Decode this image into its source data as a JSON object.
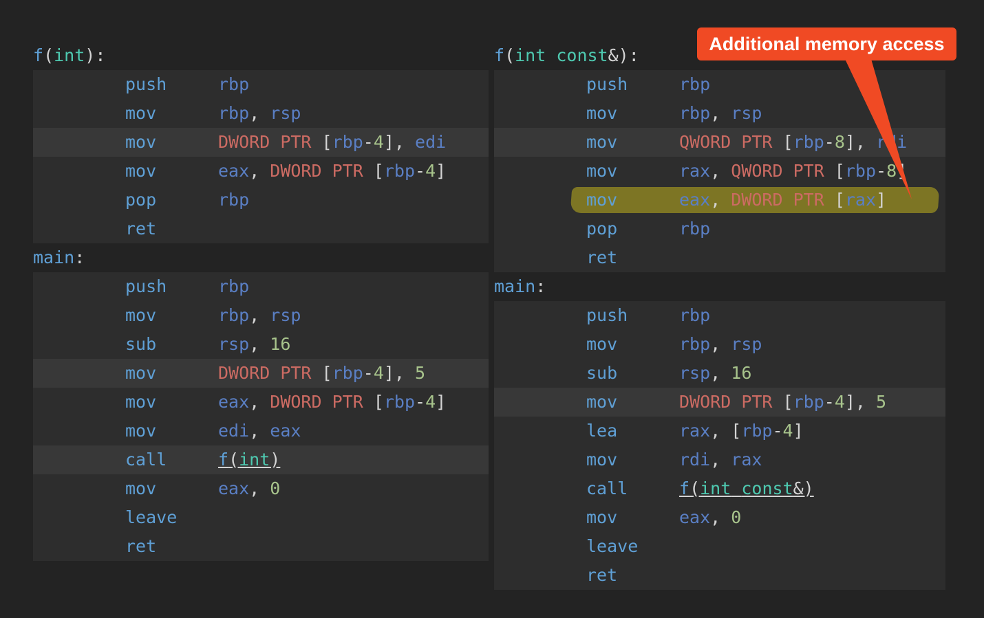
{
  "callout": {
    "text": "Additional memory access",
    "color": "#f04a24"
  },
  "colors": {
    "background": "#232323",
    "code_block": "#2d2d2d",
    "row_highlight": "#383838",
    "register": "#5a7fc4",
    "number": "#a8c48c",
    "keyword": "#cc6b63",
    "mnemonic": "#5fa0d6",
    "type": "#4ec9b0",
    "marker": "#8c8223"
  },
  "left": {
    "fn_label": [
      {
        "t": "f",
        "c": "fn"
      },
      {
        "t": "(",
        "c": "p"
      },
      {
        "t": "int",
        "c": "ty"
      },
      {
        "t": "):",
        "c": "p"
      }
    ],
    "fn_rows": [
      {
        "mn": "push",
        "ops": [
          {
            "t": "rbp",
            "c": "reg"
          }
        ]
      },
      {
        "mn": "mov",
        "ops": [
          {
            "t": "rbp",
            "c": "reg"
          },
          {
            "t": ", ",
            "c": "p"
          },
          {
            "t": "rsp",
            "c": "reg"
          }
        ]
      },
      {
        "mn": "mov",
        "hl": true,
        "ops": [
          {
            "t": "DWORD",
            "c": "kw"
          },
          {
            "t": " ",
            "c": "p"
          },
          {
            "t": "PTR",
            "c": "kw"
          },
          {
            "t": " [",
            "c": "p"
          },
          {
            "t": "rbp",
            "c": "reg"
          },
          {
            "t": "-",
            "c": "p"
          },
          {
            "t": "4",
            "c": "num"
          },
          {
            "t": "], ",
            "c": "p"
          },
          {
            "t": "edi",
            "c": "reg"
          }
        ]
      },
      {
        "mn": "mov",
        "ops": [
          {
            "t": "eax",
            "c": "reg"
          },
          {
            "t": ", ",
            "c": "p"
          },
          {
            "t": "DWORD",
            "c": "kw"
          },
          {
            "t": " ",
            "c": "p"
          },
          {
            "t": "PTR",
            "c": "kw"
          },
          {
            "t": " [",
            "c": "p"
          },
          {
            "t": "rbp",
            "c": "reg"
          },
          {
            "t": "-",
            "c": "p"
          },
          {
            "t": "4",
            "c": "num"
          },
          {
            "t": "]",
            "c": "p"
          }
        ]
      },
      {
        "mn": "pop",
        "ops": [
          {
            "t": "rbp",
            "c": "reg"
          }
        ]
      },
      {
        "mn": "ret",
        "ops": []
      }
    ],
    "main_label": [
      {
        "t": "main",
        "c": "fn"
      },
      {
        "t": ":",
        "c": "p"
      }
    ],
    "main_rows": [
      {
        "mn": "push",
        "ops": [
          {
            "t": "rbp",
            "c": "reg"
          }
        ]
      },
      {
        "mn": "mov",
        "ops": [
          {
            "t": "rbp",
            "c": "reg"
          },
          {
            "t": ", ",
            "c": "p"
          },
          {
            "t": "rsp",
            "c": "reg"
          }
        ]
      },
      {
        "mn": "sub",
        "ops": [
          {
            "t": "rsp",
            "c": "reg"
          },
          {
            "t": ", ",
            "c": "p"
          },
          {
            "t": "16",
            "c": "num"
          }
        ]
      },
      {
        "mn": "mov",
        "hl": true,
        "ops": [
          {
            "t": "DWORD",
            "c": "kw"
          },
          {
            "t": " ",
            "c": "p"
          },
          {
            "t": "PTR",
            "c": "kw"
          },
          {
            "t": " [",
            "c": "p"
          },
          {
            "t": "rbp",
            "c": "reg"
          },
          {
            "t": "-",
            "c": "p"
          },
          {
            "t": "4",
            "c": "num"
          },
          {
            "t": "], ",
            "c": "p"
          },
          {
            "t": "5",
            "c": "num"
          }
        ]
      },
      {
        "mn": "mov",
        "ops": [
          {
            "t": "eax",
            "c": "reg"
          },
          {
            "t": ", ",
            "c": "p"
          },
          {
            "t": "DWORD",
            "c": "kw"
          },
          {
            "t": " ",
            "c": "p"
          },
          {
            "t": "PTR",
            "c": "kw"
          },
          {
            "t": " [",
            "c": "p"
          },
          {
            "t": "rbp",
            "c": "reg"
          },
          {
            "t": "-",
            "c": "p"
          },
          {
            "t": "4",
            "c": "num"
          },
          {
            "t": "]",
            "c": "p"
          }
        ]
      },
      {
        "mn": "mov",
        "ops": [
          {
            "t": "edi",
            "c": "reg"
          },
          {
            "t": ", ",
            "c": "p"
          },
          {
            "t": "eax",
            "c": "reg"
          }
        ]
      },
      {
        "mn": "call",
        "hl": true,
        "ops": [
          {
            "t": "f",
            "c": "fn",
            "link": true
          },
          {
            "t": "(",
            "c": "p",
            "link": true
          },
          {
            "t": "int",
            "c": "ty",
            "link": true
          },
          {
            "t": ")",
            "c": "p",
            "link": true
          }
        ]
      },
      {
        "mn": "mov",
        "ops": [
          {
            "t": "eax",
            "c": "reg"
          },
          {
            "t": ", ",
            "c": "p"
          },
          {
            "t": "0",
            "c": "num"
          }
        ]
      },
      {
        "mn": "leave",
        "ops": []
      },
      {
        "mn": "ret",
        "ops": []
      }
    ]
  },
  "right": {
    "fn_label": [
      {
        "t": "f",
        "c": "fn"
      },
      {
        "t": "(",
        "c": "p"
      },
      {
        "t": "int",
        "c": "ty"
      },
      {
        "t": " ",
        "c": "p"
      },
      {
        "t": "const",
        "c": "ty"
      },
      {
        "t": "&):",
        "c": "p"
      }
    ],
    "fn_rows": [
      {
        "mn": "push",
        "ops": [
          {
            "t": "rbp",
            "c": "reg"
          }
        ]
      },
      {
        "mn": "mov",
        "ops": [
          {
            "t": "rbp",
            "c": "reg"
          },
          {
            "t": ", ",
            "c": "p"
          },
          {
            "t": "rsp",
            "c": "reg"
          }
        ]
      },
      {
        "mn": "mov",
        "hl": true,
        "ops": [
          {
            "t": "QWORD",
            "c": "kw"
          },
          {
            "t": " ",
            "c": "p"
          },
          {
            "t": "PTR",
            "c": "kw"
          },
          {
            "t": " [",
            "c": "p"
          },
          {
            "t": "rbp",
            "c": "reg"
          },
          {
            "t": "-",
            "c": "p"
          },
          {
            "t": "8",
            "c": "num"
          },
          {
            "t": "], ",
            "c": "p"
          },
          {
            "t": "rdi",
            "c": "reg"
          }
        ]
      },
      {
        "mn": "mov",
        "ops": [
          {
            "t": "rax",
            "c": "reg"
          },
          {
            "t": ", ",
            "c": "p"
          },
          {
            "t": "QWORD",
            "c": "kw"
          },
          {
            "t": " ",
            "c": "p"
          },
          {
            "t": "PTR",
            "c": "kw"
          },
          {
            "t": " [",
            "c": "p"
          },
          {
            "t": "rbp",
            "c": "reg"
          },
          {
            "t": "-",
            "c": "p"
          },
          {
            "t": "8",
            "c": "num"
          },
          {
            "t": "]",
            "c": "p"
          }
        ]
      },
      {
        "mn": "mov",
        "marked": true,
        "ops": [
          {
            "t": "eax",
            "c": "reg"
          },
          {
            "t": ", ",
            "c": "p"
          },
          {
            "t": "DWORD",
            "c": "kw"
          },
          {
            "t": " ",
            "c": "p"
          },
          {
            "t": "PTR",
            "c": "kw"
          },
          {
            "t": " [",
            "c": "p"
          },
          {
            "t": "rax",
            "c": "reg"
          },
          {
            "t": "]",
            "c": "p"
          }
        ]
      },
      {
        "mn": "pop",
        "ops": [
          {
            "t": "rbp",
            "c": "reg"
          }
        ]
      },
      {
        "mn": "ret",
        "ops": []
      }
    ],
    "main_label": [
      {
        "t": "main",
        "c": "fn"
      },
      {
        "t": ":",
        "c": "p"
      }
    ],
    "main_rows": [
      {
        "mn": "push",
        "ops": [
          {
            "t": "rbp",
            "c": "reg"
          }
        ]
      },
      {
        "mn": "mov",
        "ops": [
          {
            "t": "rbp",
            "c": "reg"
          },
          {
            "t": ", ",
            "c": "p"
          },
          {
            "t": "rsp",
            "c": "reg"
          }
        ]
      },
      {
        "mn": "sub",
        "ops": [
          {
            "t": "rsp",
            "c": "reg"
          },
          {
            "t": ", ",
            "c": "p"
          },
          {
            "t": "16",
            "c": "num"
          }
        ]
      },
      {
        "mn": "mov",
        "hl": true,
        "ops": [
          {
            "t": "DWORD",
            "c": "kw"
          },
          {
            "t": " ",
            "c": "p"
          },
          {
            "t": "PTR",
            "c": "kw"
          },
          {
            "t": " [",
            "c": "p"
          },
          {
            "t": "rbp",
            "c": "reg"
          },
          {
            "t": "-",
            "c": "p"
          },
          {
            "t": "4",
            "c": "num"
          },
          {
            "t": "], ",
            "c": "p"
          },
          {
            "t": "5",
            "c": "num"
          }
        ]
      },
      {
        "mn": "lea",
        "ops": [
          {
            "t": "rax",
            "c": "reg"
          },
          {
            "t": ", [",
            "c": "p"
          },
          {
            "t": "rbp",
            "c": "reg"
          },
          {
            "t": "-",
            "c": "p"
          },
          {
            "t": "4",
            "c": "num"
          },
          {
            "t": "]",
            "c": "p"
          }
        ]
      },
      {
        "mn": "mov",
        "ops": [
          {
            "t": "rdi",
            "c": "reg"
          },
          {
            "t": ", ",
            "c": "p"
          },
          {
            "t": "rax",
            "c": "reg"
          }
        ]
      },
      {
        "mn": "call",
        "ops": [
          {
            "t": "f",
            "c": "fn",
            "link": true
          },
          {
            "t": "(",
            "c": "p",
            "link": true
          },
          {
            "t": "int",
            "c": "ty",
            "link": true
          },
          {
            "t": " ",
            "c": "p",
            "link": true
          },
          {
            "t": "const",
            "c": "ty",
            "link": true
          },
          {
            "t": "&)",
            "c": "p",
            "link": true
          }
        ]
      },
      {
        "mn": "mov",
        "ops": [
          {
            "t": "eax",
            "c": "reg"
          },
          {
            "t": ", ",
            "c": "p"
          },
          {
            "t": "0",
            "c": "num"
          }
        ]
      },
      {
        "mn": "leave",
        "ops": []
      },
      {
        "mn": "ret",
        "ops": []
      }
    ]
  }
}
